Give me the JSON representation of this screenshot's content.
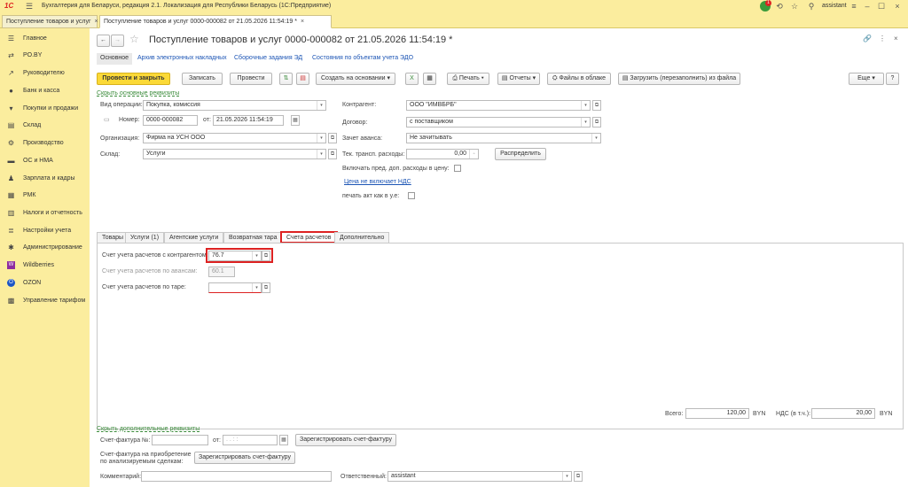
{
  "titlebar": {
    "logo": "1С",
    "title": "Бухгалтерия для Беларуси, редакция 2.1. Локализация для Республики Беларусь (1С:Предприятие)",
    "notif_count": "1",
    "user": "assistant"
  },
  "window_tabs": [
    {
      "label": "Поступление товаров и услуг"
    },
    {
      "label": "Поступление товаров и услуг 0000-000082 от 21.05.2026 11:54:19 *"
    }
  ],
  "sidebar": {
    "items": [
      {
        "label": "Главное",
        "icon": "menu-icon"
      },
      {
        "label": "PO.BY",
        "icon": "link-icon"
      },
      {
        "label": "Руководителю",
        "icon": "chart-icon"
      },
      {
        "label": "Банк и касса",
        "icon": "bank-icon"
      },
      {
        "label": "Покупки и продажи",
        "icon": "cart-icon"
      },
      {
        "label": "Склад",
        "icon": "warehouse-icon"
      },
      {
        "label": "Производство",
        "icon": "factory-icon"
      },
      {
        "label": "ОС и НМА",
        "icon": "truck-icon"
      },
      {
        "label": "Зарплата и кадры",
        "icon": "people-icon"
      },
      {
        "label": "РМК",
        "icon": "register-icon"
      },
      {
        "label": "Налоги и отчетность",
        "icon": "tax-icon"
      },
      {
        "label": "Настройки учета",
        "icon": "settings-icon"
      },
      {
        "label": "Администрирование",
        "icon": "gear-icon"
      },
      {
        "label": "Wildberries",
        "icon": "wb-icon"
      },
      {
        "label": "OZON",
        "icon": "ozon-icon"
      },
      {
        "label": "Управление тарифом",
        "icon": "tariff-icon"
      }
    ]
  },
  "doc": {
    "title": "Поступление товаров и услуг 0000-000082 от 21.05.2026 11:54:19 *",
    "nav": [
      {
        "label": "Основное"
      },
      {
        "label": "Архив электронных накладных"
      },
      {
        "label": "Сборочные задания ЭД"
      },
      {
        "label": "Состояния по объектам учета ЭДО"
      }
    ],
    "toolbar": {
      "post_close": "Провести и закрыть",
      "save": "Записать",
      "post": "Провести",
      "create_based": "Создать на основании",
      "print": "Печать",
      "reports": "Отчеты",
      "cloud_files": "Файлы в облаке",
      "load_file": "Загрузить (перезаполнить) из файла",
      "more": "Еще",
      "help": "?"
    },
    "hide_main": "Скрыть основные реквизиты",
    "fields": {
      "op_type_label": "Вид операции:",
      "op_type": "Покупка, комиссия",
      "number_label": "Номер:",
      "number": "0000-000082",
      "date_label": "от:",
      "date": "21.05.2026 11:54:19",
      "org_label": "Организация:",
      "org": "Фирма на УСН ООО",
      "warehouse_label": "Склад:",
      "warehouse": "Услуги",
      "contractor_label": "Контрагент:",
      "contractor": "ООО \"ИМВБРБ\"",
      "contract_label": "Договор:",
      "contract": "с поставщиком",
      "advance_label": "Зачет аванса:",
      "advance": "Не зачитывать",
      "transport_label": "Тек. трансп. расходы:",
      "transport": "0,00",
      "distribute": "Распределить",
      "include_label": "Включать пред. доп. расходы в цену:",
      "vat_link": "Цена не включает НДС",
      "print_act_label": "печать акт как в у.е:"
    },
    "tabs": [
      {
        "label": "Товары"
      },
      {
        "label": "Услуги (1)"
      },
      {
        "label": "Агентские услуги"
      },
      {
        "label": "Возвратная тара"
      },
      {
        "label": "Счета расчетов"
      },
      {
        "label": "Дополнительно"
      }
    ],
    "accounts": {
      "contractor_label": "Счет учета расчетов с контрагентом:",
      "contractor_value": "76.7",
      "advance_label": "Счет учета расчетов по авансам:",
      "advance_value": "60.1",
      "tare_label": "Счет учета расчетов по таре:",
      "tare_value": ""
    },
    "totals": {
      "total_label": "Всего:",
      "total": "120,00",
      "currency": "BYN",
      "vat_label": "НДС (в т.ч.):",
      "vat": "20,00",
      "vat_currency": "BYN"
    },
    "extra": {
      "hide_extra": "Скрыть дополнительные реквизиты",
      "invoice_label": "Счет-фактура №:",
      "invoice_from": "от:",
      "invoice_date": " .  .     :  :",
      "register_invoice": "Зарегистрировать счет-фактуру",
      "invoice_acq_label1": "Счет-фактура на приобретение",
      "invoice_acq_label2": "по анализируемым сделкам:",
      "register_invoice2": "Зарегистрировать счет-фактуру",
      "comment_label": "Комментарий:",
      "responsible_label": "Ответственный:",
      "responsible": "assistant"
    }
  }
}
